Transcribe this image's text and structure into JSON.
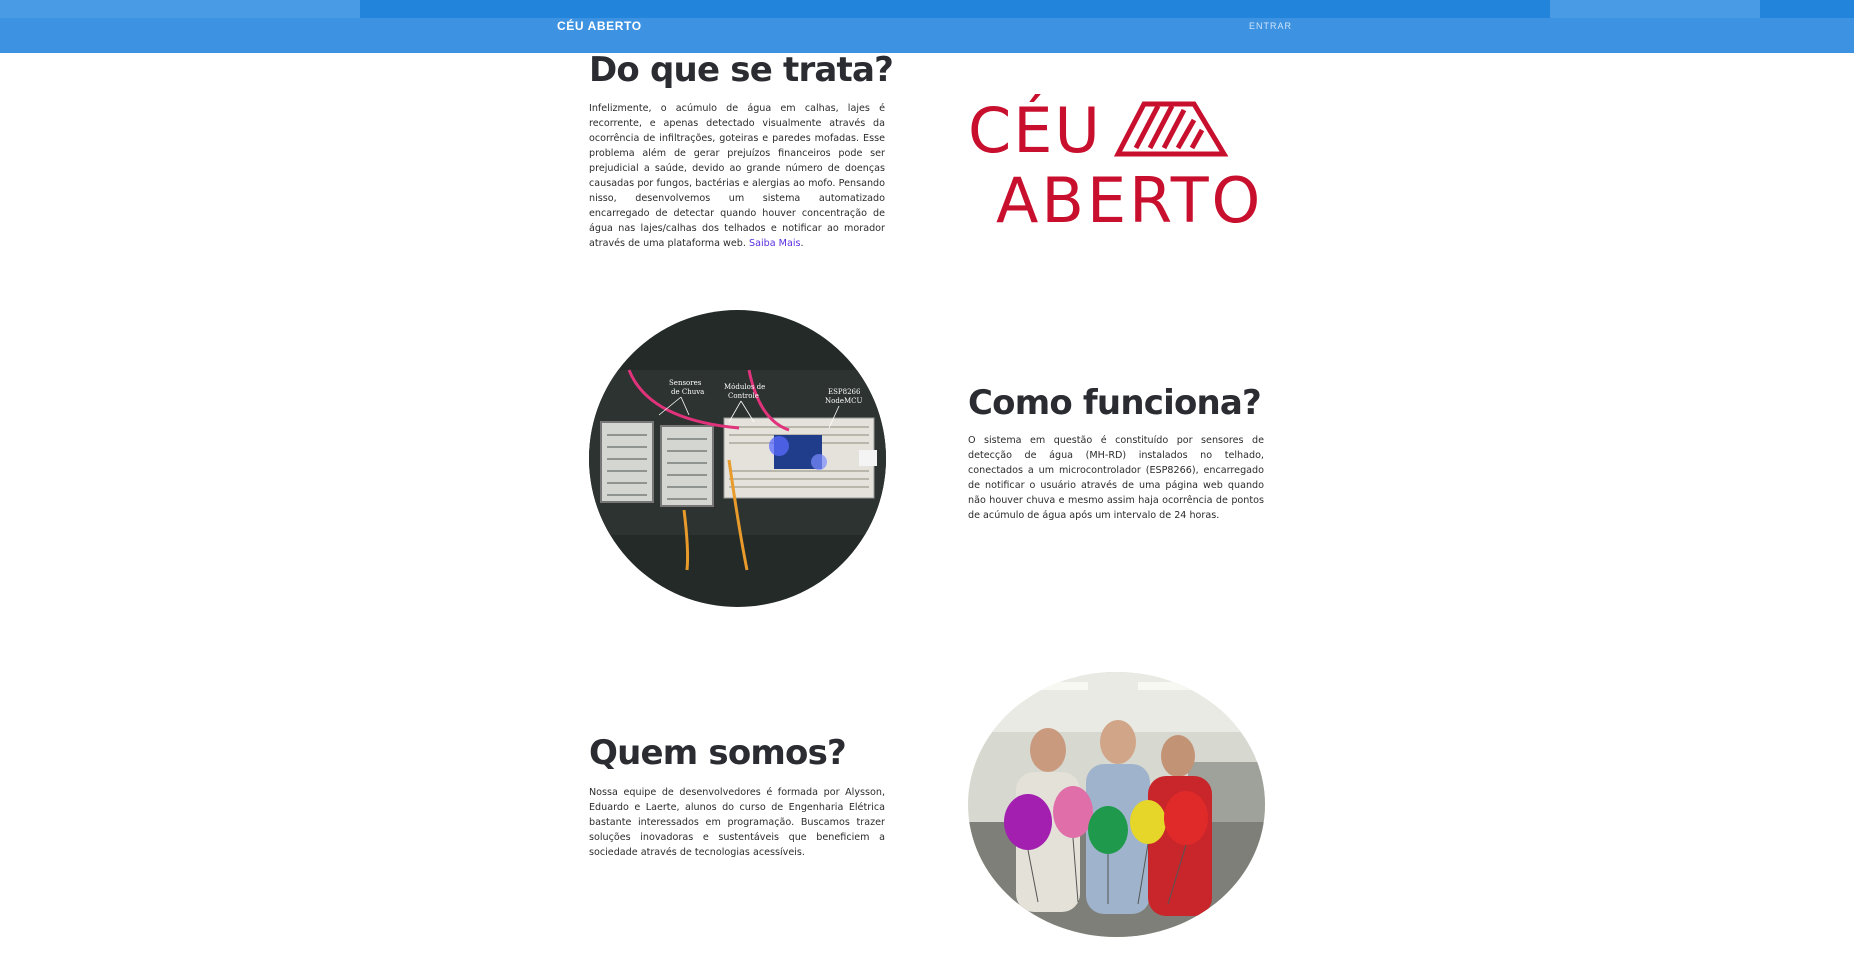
{
  "navbar": {
    "brand": "CÉU ABERTO",
    "login_label": "ENTRAR"
  },
  "colors": {
    "navbar": "#3d93e2",
    "logo_red": "#c8102e",
    "link": "#5a2ee0"
  },
  "about": {
    "title": "Do que se trata?",
    "text": "Infelizmente, o acúmulo de água em calhas, lajes é recorrente, e apenas detectado visualmente através da ocorrência de infiltrações, goteiras e paredes mofadas. Esse problema além de gerar prejuízos financeiros pode ser prejudicial a saúde, devido ao grande número de doenças causadas por fungos, bactérias e alergias ao mofo. Pensando nisso, desenvolvemos um sistema automatizado encarregado de detectar quando houver concentração de água nas lajes/calhas dos telhados e notificar ao morador através de uma plataforma web.",
    "link_label": "Saiba Mais",
    "trailing": "."
  },
  "logo": {
    "line1": "CÉU",
    "line2": "ABERTO"
  },
  "how": {
    "title": "Como funciona?",
    "text": "O sistema em questão é constituído por sensores de detecção de água (MH-RD) instalados no telhado, conectados a um microcontrolador (ESP8266), encarregado de notificar o usuário através de uma página web quando não houver chuva e mesmo assim haja ocorrência de pontos de acúmulo de água após um intervalo de 24 horas.",
    "image_labels": {
      "sensors_1": "Sensores",
      "sensors_2": "de Chuva",
      "modules_1": "Módulos de",
      "modules_2": "Controle",
      "esp_1": "ESP8266",
      "esp_2": "NodeMCU"
    }
  },
  "team": {
    "title": "Quem somos?",
    "text": "Nossa equipe de desenvolvedores é formada por Alysson, Eduardo e Laerte, alunos do curso de Engenharia Elétrica bastante interessados em programação. Buscamos trazer soluções inovadoras e sustentáveis que beneficiem a sociedade através de tecnologias acessíveis."
  }
}
